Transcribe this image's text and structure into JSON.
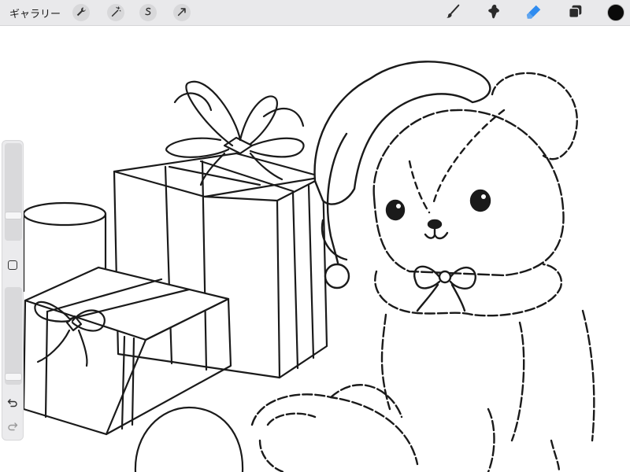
{
  "topbar": {
    "gallery_label": "ギャラリー",
    "left_tools": [
      "wrench-icon",
      "magic-wand-icon",
      "selection-icon",
      "transform-arrow-icon"
    ],
    "right_tools": [
      "brush-icon",
      "smudge-icon",
      "eraser-icon",
      "layers-icon"
    ],
    "active_tool": "eraser",
    "accent_color": "#2f8cf0",
    "current_color": "#0a0a0a"
  },
  "sidebar": {
    "brush_size_level": 0.24,
    "opacity_level": 0.04,
    "buttons": [
      "modify-square-icon",
      "undo-icon",
      "redo-icon"
    ]
  }
}
